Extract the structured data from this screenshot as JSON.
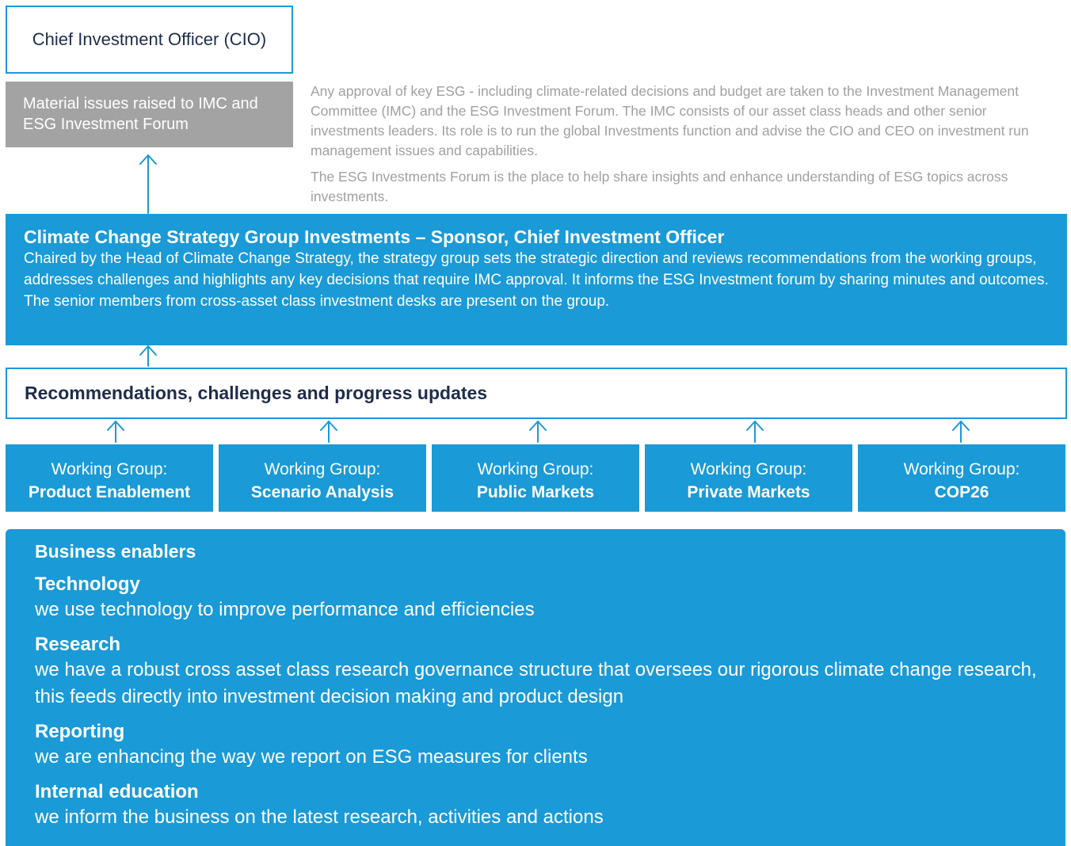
{
  "cio": {
    "label": "Chief Investment Officer (CIO)"
  },
  "material_issues": {
    "text": "Material issues raised to IMC and ESG Investment Forum"
  },
  "info": {
    "paragraph1": "Any approval of key ESG - including climate-related decisions and budget are taken to the Investment Management Committee (IMC) and the ESG Investment Forum. The IMC consists of our asset class heads and other senior investments leaders. Its role is to run the global Investments function and advise the CIO and CEO on investment run management issues and capabilities.",
    "paragraph2": "The ESG Investments Forum is the place to help share insights and enhance understanding of ESG topics across investments."
  },
  "strategy_group": {
    "title": "Climate Change Strategy Group Investments – Sponsor, Chief Investment Officer",
    "body": "Chaired by the Head of Climate Change Strategy, the strategy group sets the strategic direction and reviews recommendations from the working groups, addresses challenges and highlights any key decisions that require IMC approval. It informs the ESG Investment forum by sharing minutes and outcomes. The senior members from cross-asset class investment desks are present on the group."
  },
  "recommendations": {
    "label": "Recommendations, challenges and progress updates"
  },
  "working_groups": [
    {
      "prefix": "Working Group:",
      "name": "Product Enablement"
    },
    {
      "prefix": "Working Group:",
      "name": "Scenario Analysis"
    },
    {
      "prefix": "Working Group:",
      "name": "Public Markets"
    },
    {
      "prefix": "Working Group:",
      "name": "Private Markets"
    },
    {
      "prefix": "Working Group:",
      "name": "COP26"
    }
  ],
  "business_enablers": {
    "heading": "Business enablers",
    "items": [
      {
        "title": "Technology",
        "desc": "we use technology to improve performance and efficiencies"
      },
      {
        "title": "Research",
        "desc": "we have a robust cross asset class research governance structure that oversees our rigorous climate change research, this feeds directly into investment decision making and product design"
      },
      {
        "title": "Reporting",
        "desc": "we are enhancing the way we report on ESG measures for clients"
      },
      {
        "title": "Internal education",
        "desc": "we inform the business on the latest research, activities and actions"
      }
    ]
  },
  "colors": {
    "accent": "#1a9ad6",
    "grey": "#a3a3a3",
    "dark_text": "#1f2d4a",
    "muted_text": "#a0a0a0"
  }
}
